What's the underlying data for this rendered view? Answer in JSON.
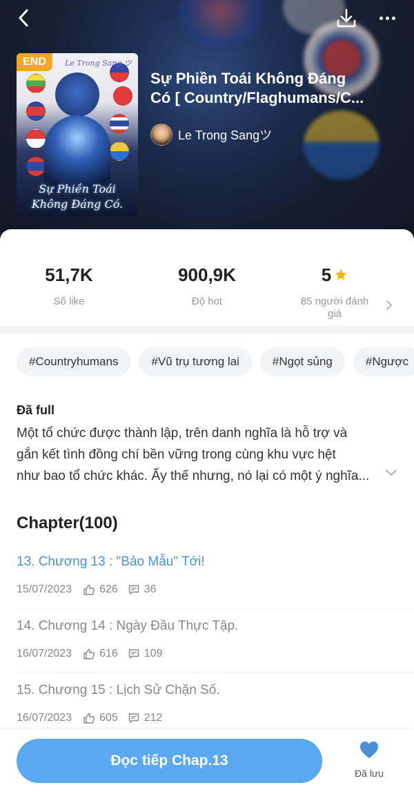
{
  "header": {
    "title_line1": "Sự Phiền Toái Không Đáng",
    "title_line2": "Có [ Country/Flaghumans/C...",
    "author": "Le Trong Sangツ",
    "status_badge": "END",
    "cover_title": "Sự Phiền Toái Không Đáng Có.",
    "cover_author": "Le Trong Sang ツ",
    "icons": {
      "back": "back-icon",
      "download": "download-icon",
      "more": "more-icon"
    }
  },
  "stats": [
    {
      "value": "51,7K",
      "label": "Số like"
    },
    {
      "value": "900,9K",
      "label": "Độ hot"
    },
    {
      "value": "5",
      "label": "85 người đánh giá",
      "icon": "star-icon"
    }
  ],
  "tags": [
    "#Countryhumans",
    "#Vũ trụ tương lai",
    "#Ngọt sủng",
    "#Ngược"
  ],
  "description": {
    "title": "Đã full",
    "line1": "Một tổ chức được thành lập, trên danh nghĩa là hỗ trợ và",
    "line2": "gắn kết tình đồng chí bền vững trong cùng khu vực hệt",
    "line3": "như bao tổ chức khác. Ấy thế nhưng, nó lại có một ý nghĩa..."
  },
  "chapters": {
    "heading": "Chapter(100)",
    "items": [
      {
        "title": "13. Chương 13 : \"Bảo Mẫu\" Tới!",
        "date": "15/07/2023",
        "likes": "626",
        "comments": "36",
        "current": true
      },
      {
        "title": "14. Chương 14 : Ngày Đầu Thực Tập.",
        "date": "16/07/2023",
        "likes": "616",
        "comments": "109",
        "current": false
      },
      {
        "title": "15. Chương 15 : Lịch Sử Chặn Số.",
        "date": "16/07/2023",
        "likes": "605",
        "comments": "212",
        "current": false
      }
    ]
  },
  "bottom": {
    "read_button": "Đọc tiếp Chap.13",
    "saved_label": "Đã lưu"
  },
  "colors": {
    "accent": "#5aa8ef",
    "current_chapter": "#4a90d9",
    "badge": "#f5a623",
    "star": "#f5b400",
    "heart": "#4a90d9"
  }
}
